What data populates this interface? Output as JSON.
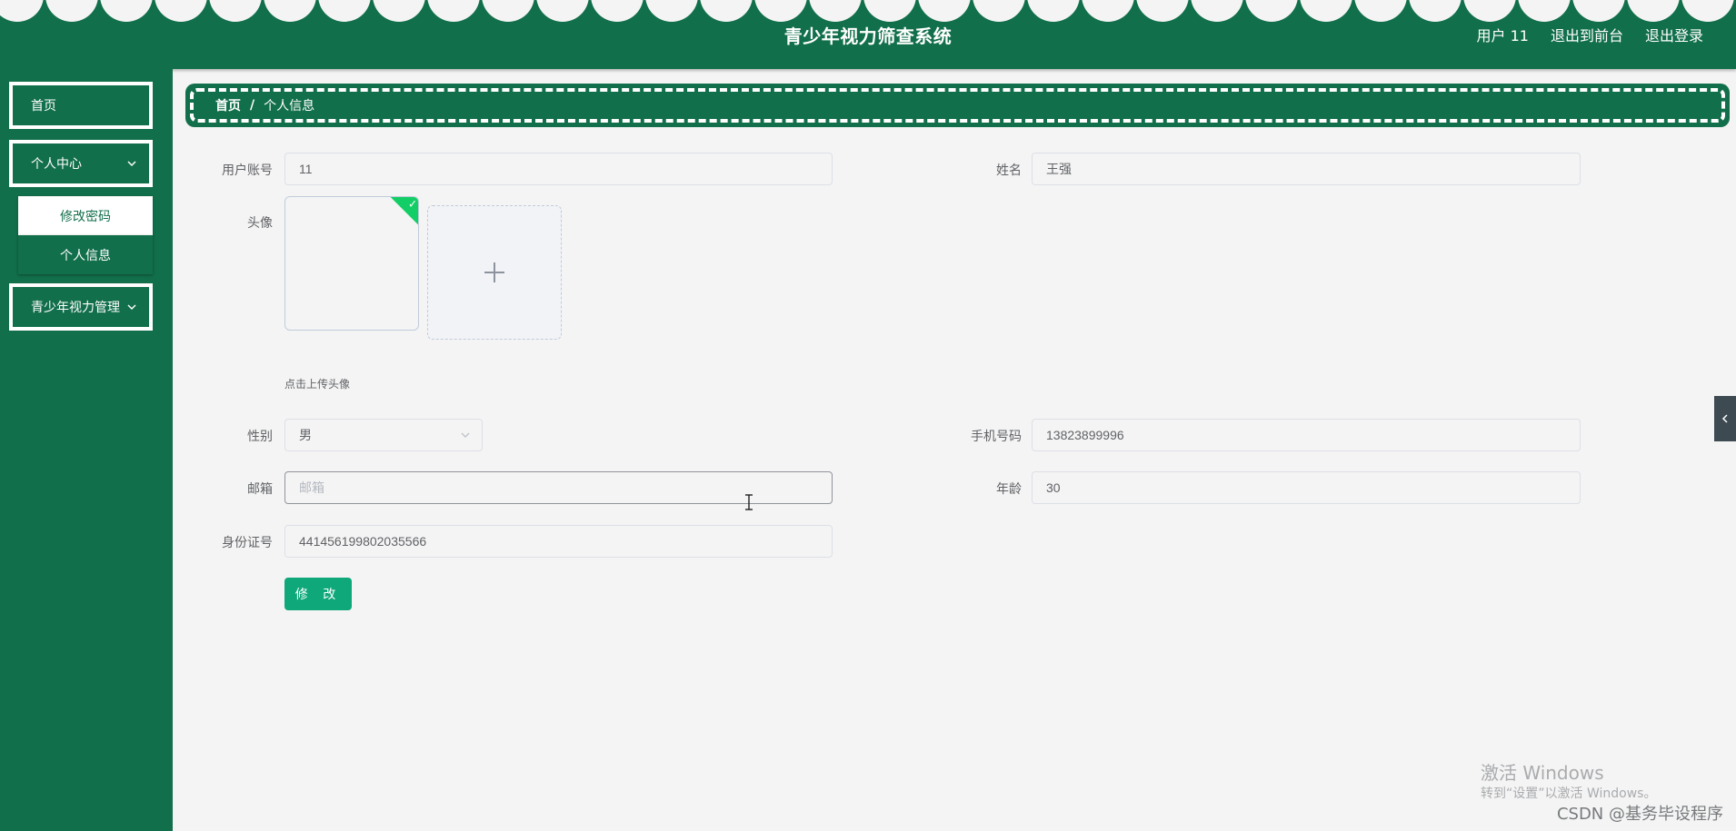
{
  "header": {
    "title": "青少年视力筛查系统",
    "user": "用户 11",
    "exit_front": "退出到前台",
    "logout": "退出登录"
  },
  "sidebar": {
    "home": "首页",
    "personal_center": "个人中心",
    "change_password": "修改密码",
    "personal_info": "个人信息",
    "vision_manage": "青少年视力管理"
  },
  "breadcrumb": {
    "home": "首页",
    "separator": "/",
    "current": "个人信息"
  },
  "form": {
    "account_label": "用户账号",
    "account_value": "11",
    "name_label": "姓名",
    "name_value": "王强",
    "avatar_label": "头像",
    "avatar_hint": "点击上传头像",
    "gender_label": "性别",
    "gender_value": "男",
    "phone_label": "手机号码",
    "phone_value": "13823899996",
    "email_label": "邮箱",
    "email_value": "",
    "email_placeholder": "邮箱",
    "age_label": "年龄",
    "age_value": "30",
    "idcard_label": "身份证号",
    "idcard_value": "441456199802035566",
    "submit_label": "修 改"
  },
  "overlay": {
    "windows_activate_title": "激活 Windows",
    "windows_activate_sub": "转到“设置”以激活 Windows。",
    "csdn_watermark": "CSDN @基务毕设程序"
  },
  "colors": {
    "brand_green": "#126f4b",
    "button_green": "#0fa87a",
    "success_check": "#13ce66",
    "page_bg": "#f4f4f4"
  },
  "icons": {
    "chevron": "chevron-down-icon",
    "upload": "plus-icon",
    "collapse": "chevron-left-icon",
    "checkmark": "check-icon"
  }
}
